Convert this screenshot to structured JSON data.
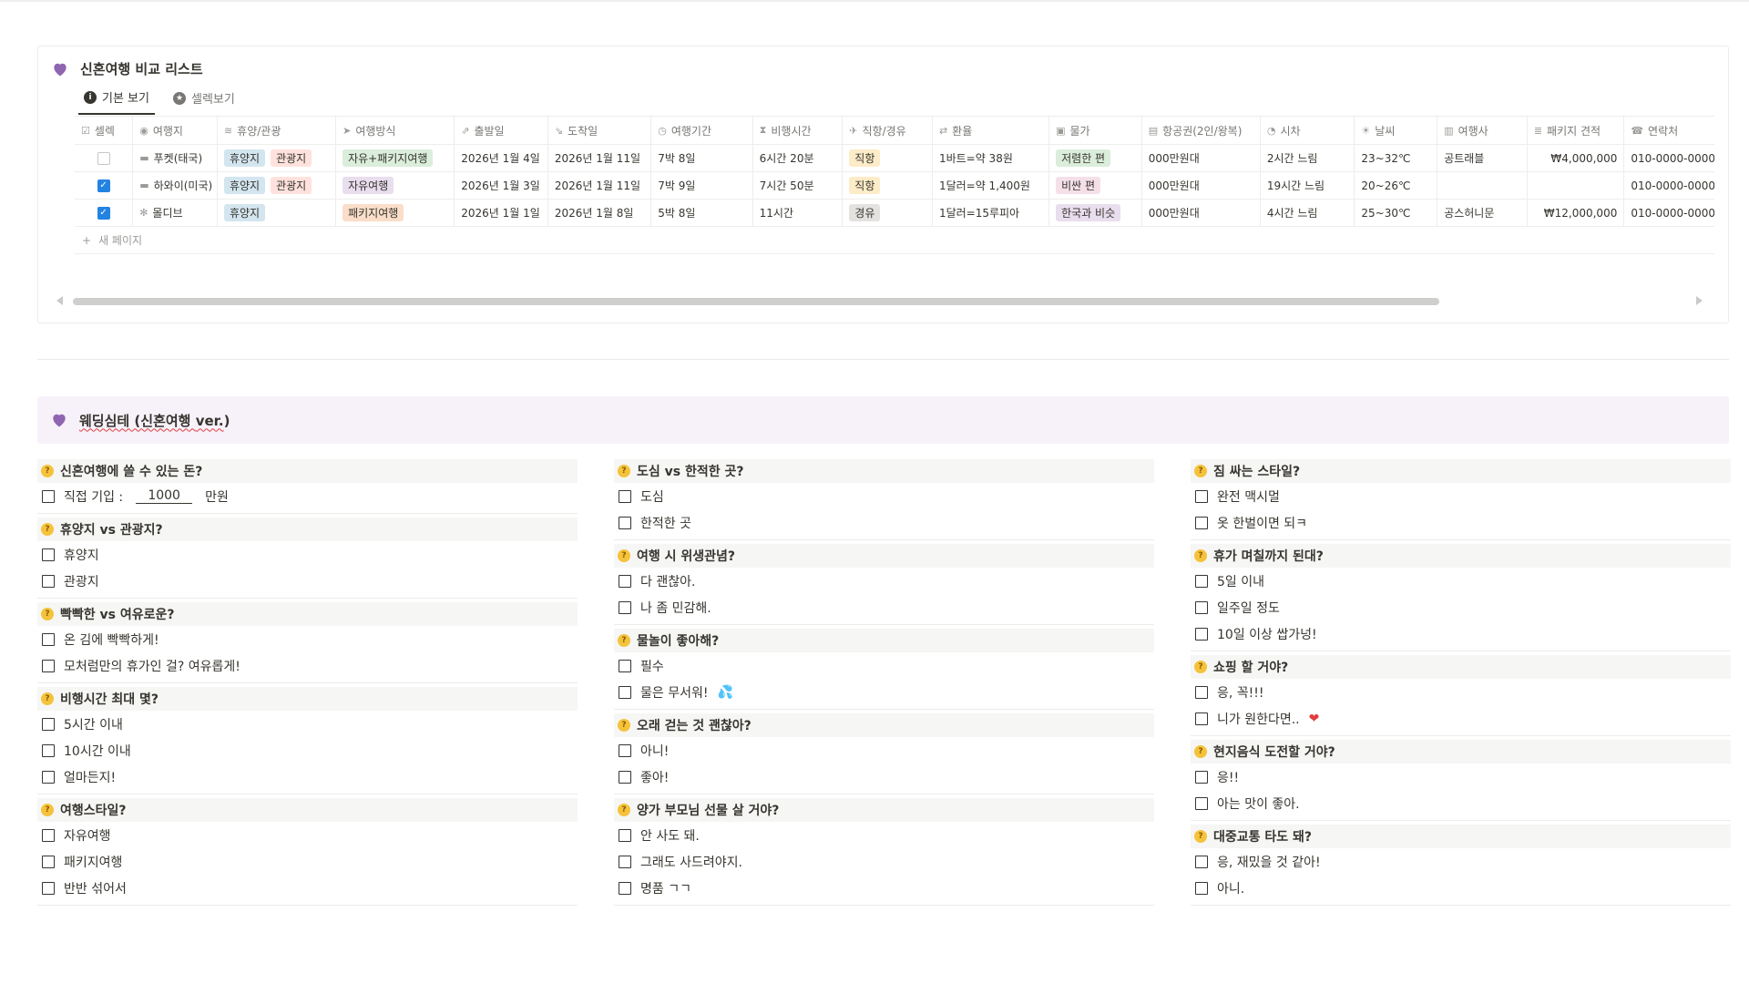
{
  "database": {
    "title": "신혼여행 비교 리스트",
    "views": [
      {
        "label": "기본 보기",
        "active": true
      },
      {
        "label": "셀렉보기",
        "active": false
      }
    ],
    "columns": [
      {
        "label": "셀렉",
        "icon": "checkbox-icon"
      },
      {
        "label": "여행지",
        "icon": "status-icon"
      },
      {
        "label": "휴양/관광",
        "icon": "multiselect-icon"
      },
      {
        "label": "여행방식",
        "icon": "send-icon"
      },
      {
        "label": "출발일",
        "icon": "plane-takeoff-icon"
      },
      {
        "label": "도착일",
        "icon": "plane-landing-icon"
      },
      {
        "label": "여행기간",
        "icon": "clock-icon"
      },
      {
        "label": "비행시간",
        "icon": "hourglass-icon"
      },
      {
        "label": "직항/경유",
        "icon": "airplane-icon"
      },
      {
        "label": "환율",
        "icon": "exchange-icon"
      },
      {
        "label": "물가",
        "icon": "money-icon"
      },
      {
        "label": "항공권(2인/왕복)",
        "icon": "ticket-icon"
      },
      {
        "label": "시차",
        "icon": "time-icon"
      },
      {
        "label": "날씨",
        "icon": "sun-icon"
      },
      {
        "label": "여행사",
        "icon": "agency-icon"
      },
      {
        "label": "패키지 견적",
        "icon": "stack-icon"
      },
      {
        "label": "연락처",
        "icon": "phone-icon"
      }
    ],
    "rows": [
      {
        "selected": false,
        "destination": "푸켓(태국)",
        "type_tags": [
          "휴양지",
          "관광지"
        ],
        "style_tag": "자유+패키지여행",
        "depart": "2026년 1월 4일",
        "arrive": "2026년 1월 11일",
        "duration": "7박 8일",
        "flight_time": "6시간 20분",
        "route": "직항",
        "exchange": "1바트=약 38원",
        "price_tag": "저렴한 편",
        "airfare": "000만원대",
        "time_diff": "2시간 느림",
        "weather": "23~32℃",
        "agency": "공트래블",
        "package": "₩4,000,000",
        "contact": "010-0000-0000"
      },
      {
        "selected": true,
        "destination": "하와이(미국)",
        "type_tags": [
          "휴양지",
          "관광지"
        ],
        "style_tag": "자유여행",
        "depart": "2026년 1월 3일",
        "arrive": "2026년 1월 11일",
        "duration": "7박 9일",
        "flight_time": "7시간 50분",
        "route": "직항",
        "exchange": "1달러=약 1,400원",
        "price_tag": "비싼 편",
        "airfare": "000만원대",
        "time_diff": "19시간 느림",
        "weather": "20~26℃",
        "agency": "",
        "package": "",
        "contact": "010-0000-0000"
      },
      {
        "selected": true,
        "destination": "몰디브",
        "type_tags": [
          "휴양지"
        ],
        "style_tag": "패키지여행",
        "depart": "2026년 1월 1일",
        "arrive": "2026년 1월 8일",
        "duration": "5박 8일",
        "flight_time": "11시간",
        "route": "경유",
        "exchange": "1달러=15루피아",
        "price_tag": "한국과 비슷",
        "airfare": "000만원대",
        "time_diff": "4시간 느림",
        "weather": "25~30℃",
        "agency": "공스허니문",
        "package": "₩12,000,000",
        "contact": "010-0000-0000"
      }
    ],
    "new_page_label": "새 페이지"
  },
  "callout": {
    "title_prefix": "웨딩심테 (신혼여행 ",
    "title_suffix_underlined": "ver.",
    "title_end": ")"
  },
  "questions": {
    "col1": [
      {
        "q": "신혼여행에 쓸 수 있는 돈?",
        "options": [
          {
            "text": "직접 기입 :",
            "input": "1000",
            "after": "만원"
          }
        ]
      },
      {
        "q": "휴양지 vs 관광지?",
        "options": [
          {
            "text": "휴양지"
          },
          {
            "text": "관광지"
          }
        ]
      },
      {
        "q": "빡빡한 vs 여유로운?",
        "options": [
          {
            "text": "온 김에 빡빡하게!"
          },
          {
            "text": "모처럼만의 휴가인 걸? 여유롭게!"
          }
        ]
      },
      {
        "q": "비행시간 최대 몇?",
        "options": [
          {
            "text": "5시간 이내"
          },
          {
            "text": "10시간 이내"
          },
          {
            "text": "얼마든지!"
          }
        ]
      },
      {
        "q": "여행스타일?",
        "options": [
          {
            "text": "자유여행"
          },
          {
            "text": "패키지여행"
          },
          {
            "text": "반반 섞어서"
          }
        ]
      }
    ],
    "col2": [
      {
        "q": "도심 vs 한적한 곳?",
        "options": [
          {
            "text": "도심"
          },
          {
            "text": "한적한 곳"
          }
        ]
      },
      {
        "q": "여행 시 위생관념?",
        "options": [
          {
            "text": "다 괜찮아."
          },
          {
            "text": "나 좀 민감해."
          }
        ]
      },
      {
        "q": "물놀이 좋아해?",
        "options": [
          {
            "text": "필수"
          },
          {
            "text": "물은 무서워!",
            "emoji": "💦"
          }
        ]
      },
      {
        "q": "오래 걷는 것 괜찮아?",
        "options": [
          {
            "text": "아니!"
          },
          {
            "text": "좋아!"
          }
        ]
      },
      {
        "q": "양가 부모님 선물 살 거야?",
        "options": [
          {
            "text": "안 사도 돼."
          },
          {
            "text": "그래도 사드려야지."
          },
          {
            "text": "명품 ㄱㄱ"
          }
        ]
      }
    ],
    "col3": [
      {
        "q": "짐 싸는 스타일?",
        "options": [
          {
            "text": "완전 맥시멀"
          },
          {
            "text": "옷 한벌이면 되ㅋ"
          }
        ]
      },
      {
        "q": "휴가 며칠까지 된대?",
        "options": [
          {
            "text": "5일 이내"
          },
          {
            "text": "일주일 정도"
          },
          {
            "text": "10일 이상 쌉가넝!"
          }
        ]
      },
      {
        "q": "쇼핑 할 거야?",
        "options": [
          {
            "text": "응, 꼭!!!"
          },
          {
            "text": "니가 원한다면..",
            "emoji": "❤"
          }
        ]
      },
      {
        "q": "현지음식 도전할 거야?",
        "options": [
          {
            "text": "응!!"
          },
          {
            "text": "아는 맛이 좋아."
          }
        ]
      },
      {
        "q": "대중교통 타도 돼?",
        "options": [
          {
            "text": "응, 재밌을 것 같아!"
          },
          {
            "text": "아니."
          }
        ]
      }
    ]
  },
  "colors": {
    "heart": "#9065b0",
    "callout_bg": "#f7f1fa",
    "checkbox_checked": "#2383e2",
    "think_emoji": "#f5c33b"
  }
}
